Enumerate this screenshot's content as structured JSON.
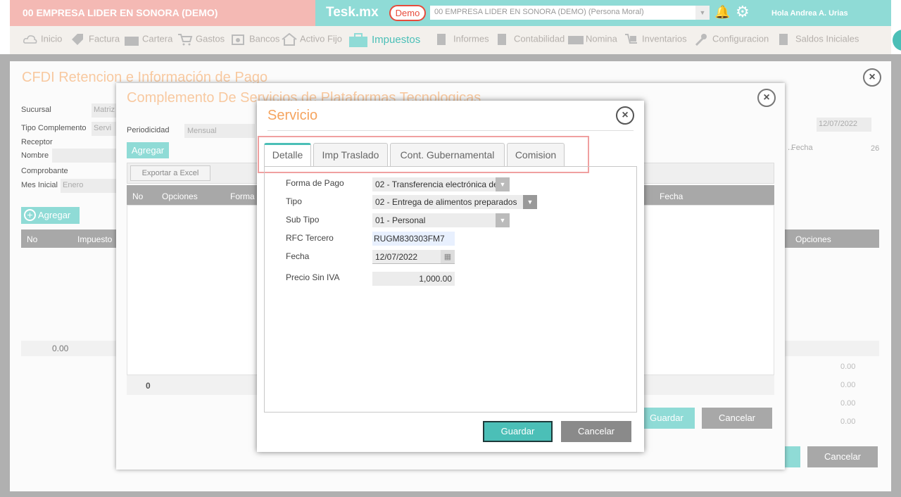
{
  "header": {
    "company_left": "00 EMPRESA LIDER EN SONORA (DEMO)",
    "brand": "Tesk.mx",
    "demo_badge": "Demo",
    "company_select": "00 EMPRESA LIDER EN SONORA (DEMO) (Persona Moral)",
    "greeting": "Hola Andrea A. Urias"
  },
  "nav": {
    "items": [
      "Inicio",
      "Factura",
      "Cartera",
      "Gastos",
      "Bancos",
      "Activo Fijo",
      "Impuestos",
      "Informes",
      "Contabilidad",
      "Nomina",
      "Inventarios",
      "Configuracion",
      "Saldos Iniciales"
    ]
  },
  "win1": {
    "title": "CFDI Retencion e Información de Pago",
    "labels": {
      "sucursal": "Sucursal",
      "tipo_complemento": "Tipo Complemento",
      "receptor": "Receptor",
      "nombre": "Nombre",
      "comprobante": "Comprobante",
      "mes_inicial": "Mes Inicial",
      "fecha": "Fecha"
    },
    "values": {
      "sucursal": "Matriz",
      "tipo_complemento": "Servi",
      "mes_inicial": "Enero",
      "fecha": "12/07/2022",
      "right_num": "26",
      "ellipsis": "..."
    },
    "add_button": "Agregar",
    "table_headers": {
      "no": "No",
      "impuesto": "Impuesto",
      "opciones": "Opciones"
    },
    "footer_value": "0.00",
    "totals": [
      "0.00",
      "0.00",
      "0.00",
      "0.00"
    ],
    "cancel": "Cancelar"
  },
  "win2": {
    "title": "Complemento De Servicios de Plataformas Tecnologicas",
    "periodicidad_label": "Periodicidad",
    "periodicidad_value": "Mensual",
    "add_button": "Agregar",
    "export_button": "Exportar a Excel",
    "table_headers": {
      "no": "No",
      "opciones": "Opciones",
      "forma": "Forma",
      "fecha": "Fecha"
    },
    "footer_value": "0",
    "save": "Guardar",
    "cancel": "Cancelar"
  },
  "dialog": {
    "title": "Servicio",
    "tabs": [
      "Detalle",
      "Imp Traslado",
      "Cont. Gubernamental",
      "Comision"
    ],
    "fields": {
      "forma_pago": {
        "label": "Forma de Pago",
        "value": "02 - Transferencia electrónica de"
      },
      "tipo": {
        "label": "Tipo",
        "value": "02 - Entrega de alimentos preparados"
      },
      "sub_tipo": {
        "label": "Sub Tipo",
        "value": "01 - Personal"
      },
      "rfc_tercero": {
        "label": "RFC Tercero",
        "value": "RUGM830303FM7"
      },
      "fecha": {
        "label": "Fecha",
        "value": "12/07/2022"
      },
      "precio_sin_iva": {
        "label": "Precio Sin IVA",
        "value": "1,000.00"
      }
    },
    "save": "Guardar",
    "cancel": "Cancelar"
  },
  "colors": {
    "teal": "#4bbfb7",
    "pink": "#f4b9b4",
    "highlight": "#f0a0a0",
    "orange": "#f5a45f"
  }
}
